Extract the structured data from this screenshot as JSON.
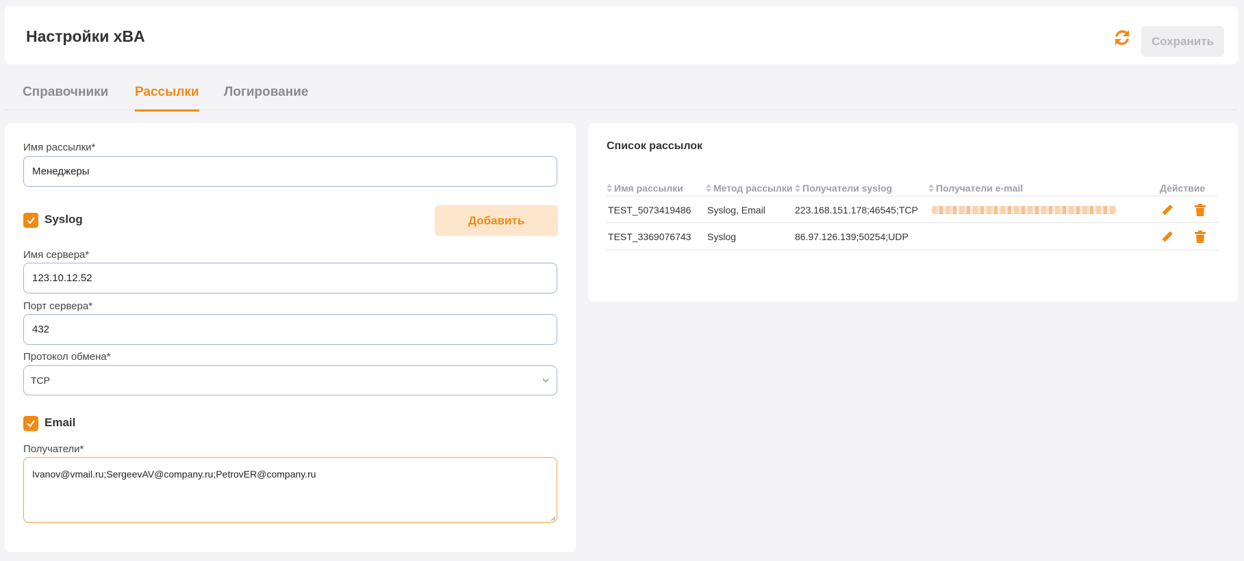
{
  "header": {
    "title": "Настройки xBA",
    "save_label": "Сохранить"
  },
  "tabs": [
    {
      "label": "Справочники",
      "active": false
    },
    {
      "label": "Рассылки",
      "active": true
    },
    {
      "label": "Логирование",
      "active": false
    }
  ],
  "form": {
    "name_label": "Имя рассылки*",
    "name_value": "Менеджеры",
    "syslog_label": "Syslog",
    "syslog_checked": true,
    "add_label": "Добавить",
    "server_label": "Имя сервера*",
    "server_value": "123.10.12.52",
    "port_label": "Порт сервера*",
    "port_value": "432",
    "protocol_label": "Протокол обмена*",
    "protocol_value": "TCP",
    "email_label": "Email",
    "email_checked": true,
    "recipients_label": "Получатели*",
    "recipients_value": "Ivanov@vmail.ru;SergeevAV@company.ru;PetrovER@company.ru"
  },
  "list": {
    "title": "Список рассылок",
    "columns": [
      "Имя рассылки",
      "Метод рассылки",
      "Получатели syslog",
      "Получатели e-mail",
      "Действие"
    ],
    "rows": [
      {
        "name": "TEST_5073419486",
        "method": "Syslog, Email",
        "syslog": "223.168.151.178;46545;TCP",
        "email_blurred": true
      },
      {
        "name": "TEST_3369076743",
        "method": "Syslog",
        "syslog": "86.97.126.139;50254;UDP",
        "email_blurred": false
      }
    ]
  },
  "colors": {
    "accent": "#f08a14",
    "accent_light": "#fde6cc",
    "input_border": "#a3b2cf",
    "background": "#f4f4f6"
  },
  "icons": {
    "refresh": "refresh-icon",
    "edit": "pencil-icon",
    "delete": "trash-icon",
    "dropdown": "chevron-down-icon",
    "check": "check-icon"
  }
}
